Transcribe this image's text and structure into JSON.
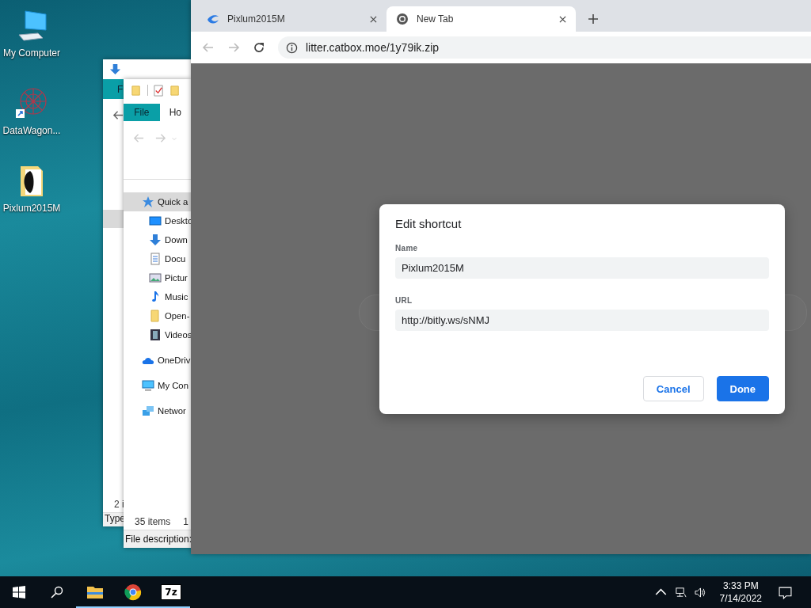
{
  "desktop_icons": [
    {
      "label": "My Computer",
      "kind": "computer"
    },
    {
      "label": "DataWagon...",
      "kind": "web"
    },
    {
      "label": "Pixlum2015M",
      "kind": "folder"
    }
  ],
  "explorer_back": {
    "ribbon_tab": "F",
    "status": "2 i",
    "details_header": "Type"
  },
  "explorer_front": {
    "ribbon_tabs": [
      {
        "label": "File",
        "selected": true
      },
      {
        "label": "Ho",
        "selected": false
      }
    ],
    "nav_items": [
      {
        "label": "Quick a",
        "kind": "star",
        "selected": true,
        "children": [
          {
            "label": "Deskto",
            "kind": "desktop",
            "selected": false
          },
          {
            "label": "Down",
            "kind": "download",
            "selected": false
          },
          {
            "label": "Docu",
            "kind": "document",
            "selected": false
          },
          {
            "label": "Pictur",
            "kind": "pictures",
            "selected": false
          },
          {
            "label": "Music",
            "kind": "music",
            "selected": false
          },
          {
            "label": "Open-",
            "kind": "folder",
            "selected": false
          },
          {
            "label": "Videos",
            "kind": "video",
            "selected": false
          }
        ]
      },
      {
        "label": "OneDriv",
        "kind": "cloud",
        "selected": false
      },
      {
        "label": "My Con",
        "kind": "computer",
        "selected": false
      },
      {
        "label": "Networ",
        "kind": "network",
        "selected": false
      }
    ],
    "status": "35 items",
    "status_extra": "1",
    "details_pane": "File description:"
  },
  "browser": {
    "tabs": [
      {
        "title": "Pixlum2015M",
        "kind": "site",
        "selected": false
      },
      {
        "title": "New Tab",
        "kind": "chrome",
        "selected": true
      }
    ],
    "address": "litter.catbox.moe/1y79ik.zip"
  },
  "dialog": {
    "title": "Edit shortcut",
    "fields": [
      {
        "label": "Name",
        "value": "Pixlum2015M"
      },
      {
        "label": "URL",
        "value": "http://bitly.ws/sNMJ"
      }
    ],
    "buttons": [
      {
        "label": "Cancel",
        "kind": "secondary"
      },
      {
        "label": "Done",
        "kind": "primary"
      }
    ]
  },
  "taskbar": {
    "apps": [
      {
        "kind": "explorer",
        "running": true
      },
      {
        "kind": "chrome",
        "running": true
      },
      {
        "kind": "archiver",
        "label": "7z",
        "running": true
      }
    ],
    "time": "3:33 PM",
    "date": "7/14/2022"
  }
}
